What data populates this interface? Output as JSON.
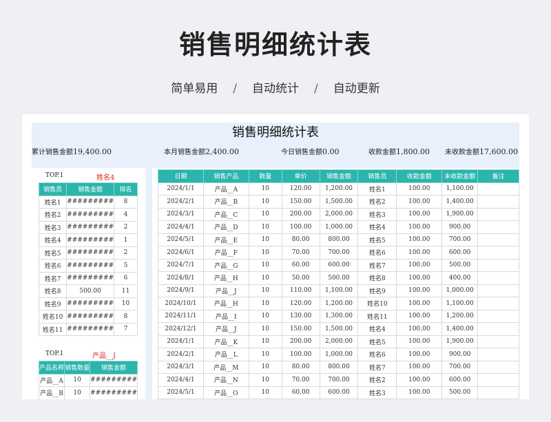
{
  "hero": {
    "title": "销售明细统计表",
    "subs": [
      "简单易用",
      "自动统计",
      "自动更新"
    ],
    "sep": "/"
  },
  "sheet": {
    "title": "销售明细统计表",
    "summary": [
      {
        "label": "累计销售金额",
        "value": "19,400.00"
      },
      {
        "label": "本月销售金额",
        "value": "2,400.00"
      },
      {
        "label": "今日销售金额",
        "value": "0.00"
      },
      {
        "label": "收款金额",
        "value": "1,800.00"
      },
      {
        "label": "未收款金额",
        "value": "17,600.00"
      }
    ]
  },
  "top_sales": {
    "top_label": "TOP.1",
    "top_name": "姓名4",
    "headers": [
      "销售员",
      "销售金额",
      "排名"
    ],
    "rows": [
      [
        "姓名1",
        "#########",
        "8"
      ],
      [
        "姓名2",
        "#########",
        "4"
      ],
      [
        "姓名3",
        "#########",
        "2"
      ],
      [
        "姓名4",
        "#########",
        "1"
      ],
      [
        "姓名5",
        "#########",
        "2"
      ],
      [
        "姓名6",
        "#########",
        "5"
      ],
      [
        "姓名7",
        "#########",
        "6"
      ],
      [
        "姓名8",
        "500.00",
        "11"
      ],
      [
        "姓名9",
        "#########",
        "10"
      ],
      [
        "姓名10",
        "#########",
        "8"
      ],
      [
        "姓名11",
        "#########",
        "7"
      ]
    ]
  },
  "top_products": {
    "top_label": "TOP.1",
    "top_name": "产品__J",
    "headers": [
      "产品名称",
      "销售数量",
      "销售金额"
    ],
    "rows": [
      [
        "产品__A",
        "10",
        "#########"
      ],
      [
        "产品__B",
        "10",
        "#########"
      ]
    ]
  },
  "details": {
    "headers": [
      "日期",
      "销售产品",
      "数量",
      "单价",
      "销售金额",
      "销售员",
      "收款金额",
      "未收款金额",
      "备注"
    ],
    "rows": [
      [
        "2024/1/1",
        "产品__A",
        "10",
        "120.00",
        "1,200.00",
        "姓名1",
        "100.00",
        "1,100.00",
        ""
      ],
      [
        "2024/2/1",
        "产品__B",
        "10",
        "150.00",
        "1,500.00",
        "姓名2",
        "100.00",
        "1,400.00",
        ""
      ],
      [
        "2024/3/1",
        "产品__C",
        "10",
        "200.00",
        "2,000.00",
        "姓名3",
        "100.00",
        "1,900.00",
        ""
      ],
      [
        "2024/4/1",
        "产品__D",
        "10",
        "100.00",
        "1,000.00",
        "姓名4",
        "100.00",
        "900.00",
        ""
      ],
      [
        "2024/5/1",
        "产品__E",
        "10",
        "80.00",
        "800.00",
        "姓名5",
        "100.00",
        "700.00",
        ""
      ],
      [
        "2024/6/1",
        "产品__F",
        "10",
        "70.00",
        "700.00",
        "姓名6",
        "100.00",
        "600.00",
        ""
      ],
      [
        "2024/7/1",
        "产品__G",
        "10",
        "60.00",
        "600.00",
        "姓名7",
        "100.00",
        "500.00",
        ""
      ],
      [
        "2024/8/1",
        "产品__H",
        "10",
        "50.00",
        "500.00",
        "姓名8",
        "100.00",
        "400.00",
        ""
      ],
      [
        "2024/9/1",
        "产品__J",
        "10",
        "110.00",
        "1,100.00",
        "姓名9",
        "100.00",
        "1,000.00",
        ""
      ],
      [
        "2024/10/1",
        "产品__H",
        "10",
        "120.00",
        "1,200.00",
        "姓名10",
        "100.00",
        "1,100.00",
        ""
      ],
      [
        "2024/11/1",
        "产品__I",
        "10",
        "130.00",
        "1,300.00",
        "姓名11",
        "100.00",
        "1,200.00",
        ""
      ],
      [
        "2024/12/1",
        "产品__J",
        "10",
        "150.00",
        "1,500.00",
        "姓名4",
        "100.00",
        "1,400.00",
        ""
      ],
      [
        "2024/1/1",
        "产品__K",
        "10",
        "200.00",
        "2,000.00",
        "姓名5",
        "100.00",
        "1,900.00",
        ""
      ],
      [
        "2024/2/1",
        "产品__L",
        "10",
        "100.00",
        "1,000.00",
        "姓名6",
        "100.00",
        "900.00",
        ""
      ],
      [
        "2024/3/1",
        "产品__M",
        "10",
        "80.00",
        "800.00",
        "姓名7",
        "100.00",
        "700.00",
        ""
      ],
      [
        "2024/4/1",
        "产品__N",
        "10",
        "70.00",
        "700.00",
        "姓名2",
        "100.00",
        "600.00",
        ""
      ],
      [
        "2024/5/1",
        "产品__O",
        "10",
        "60.00",
        "600.00",
        "姓名3",
        "100.00",
        "500.00",
        ""
      ]
    ]
  },
  "colors": {
    "header": "#2bb5ac",
    "band": "#e8f0fb",
    "accent": "#e02020"
  }
}
